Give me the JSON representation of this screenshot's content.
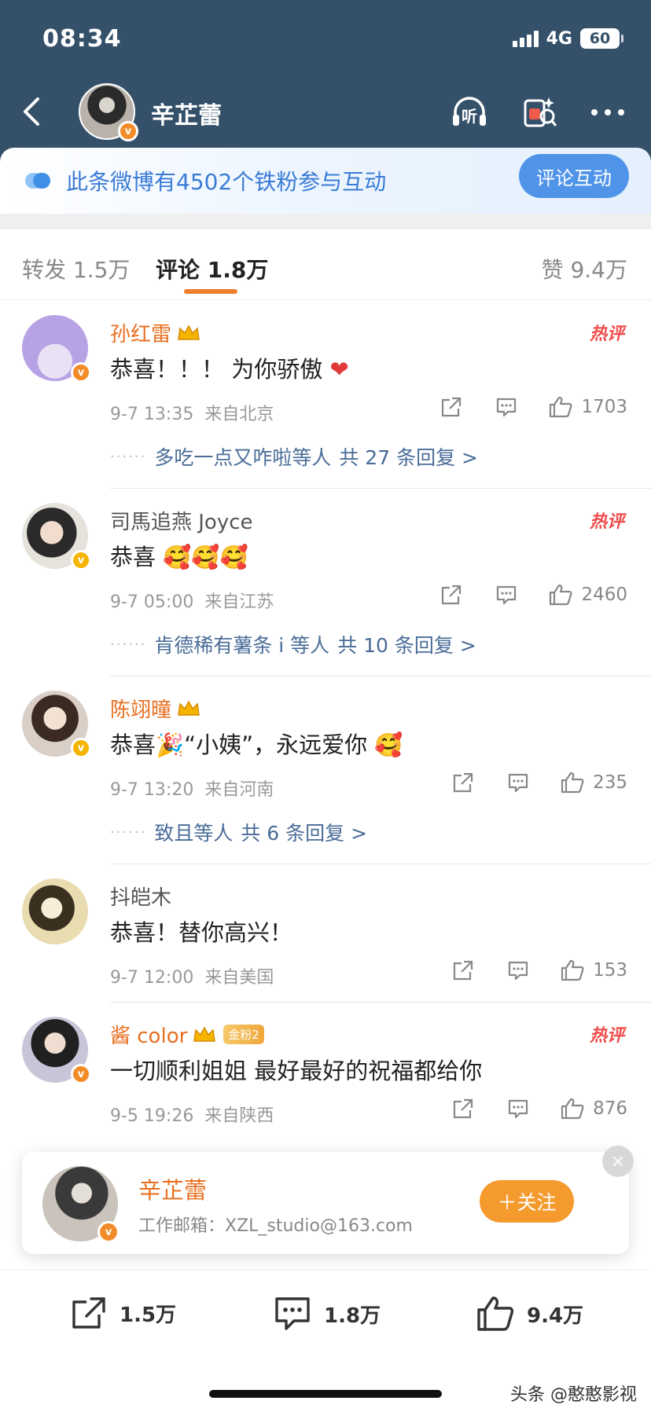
{
  "status_bar": {
    "time": "08:34",
    "network": "4G",
    "battery": "60"
  },
  "nav": {
    "title": "辛芷蕾"
  },
  "banner": {
    "text": "此条微博有4502个铁粉参与互动",
    "button": "评论互动"
  },
  "tabs": {
    "repost": "转发 1.5万",
    "comment": "评论 1.8万",
    "like": "赞 9.4万"
  },
  "comments": [
    {
      "user": "孙红雷",
      "hot": "热评",
      "text": "恭喜！！！ 为你骄傲",
      "emoji": "❤",
      "time": "9-7 13:35",
      "location": "来自北京",
      "likes": "1703",
      "replies_by": "多吃一点又咋啦等人",
      "replies_count": "共 27 条回复 >"
    },
    {
      "user": "司馬追燕 Joyce",
      "hot": "热评",
      "text": "恭喜",
      "emoji": "🥰🥰🥰",
      "time": "9-7 05:00",
      "location": "来自江苏",
      "likes": "2460",
      "replies_by": "肯德稀有薯条 i 等人",
      "replies_count": "共 10 条回复 >"
    },
    {
      "user": "陈翊曈",
      "text": "恭喜🎉“小姨”，永远爱你",
      "emoji": "🥰",
      "time": "9-7 13:20",
      "location": "来自河南",
      "likes": "235",
      "replies_by": "致且等人",
      "replies_count": "共 6 条回复 >"
    },
    {
      "user": "抖皑木",
      "text": "恭喜！替你高兴！",
      "time": "9-7 12:00",
      "location": "来自美国",
      "likes": "153"
    },
    {
      "user": "酱 color",
      "fan_badge": "金粉2",
      "hot": "热评",
      "text": "一切顺利姐姐 最好最好的祝福都给你",
      "time": "9-5 19:26",
      "location": "来自陕西",
      "likes": "876"
    }
  ],
  "follow_card": {
    "name": "辛芷蕾",
    "email": "工作邮箱：XZL_studio@163.com",
    "follow": "＋关注",
    "close": "×"
  },
  "bottom_bar": {
    "repost": "1.5万",
    "comment": "1.8万",
    "like": "9.4万"
  },
  "watermark": "头条 @憨憨影视",
  "colors": {
    "header": "#35516a",
    "accent": "#ef7f2f",
    "link": "#4a6c98",
    "hot": "#f04e4e"
  }
}
